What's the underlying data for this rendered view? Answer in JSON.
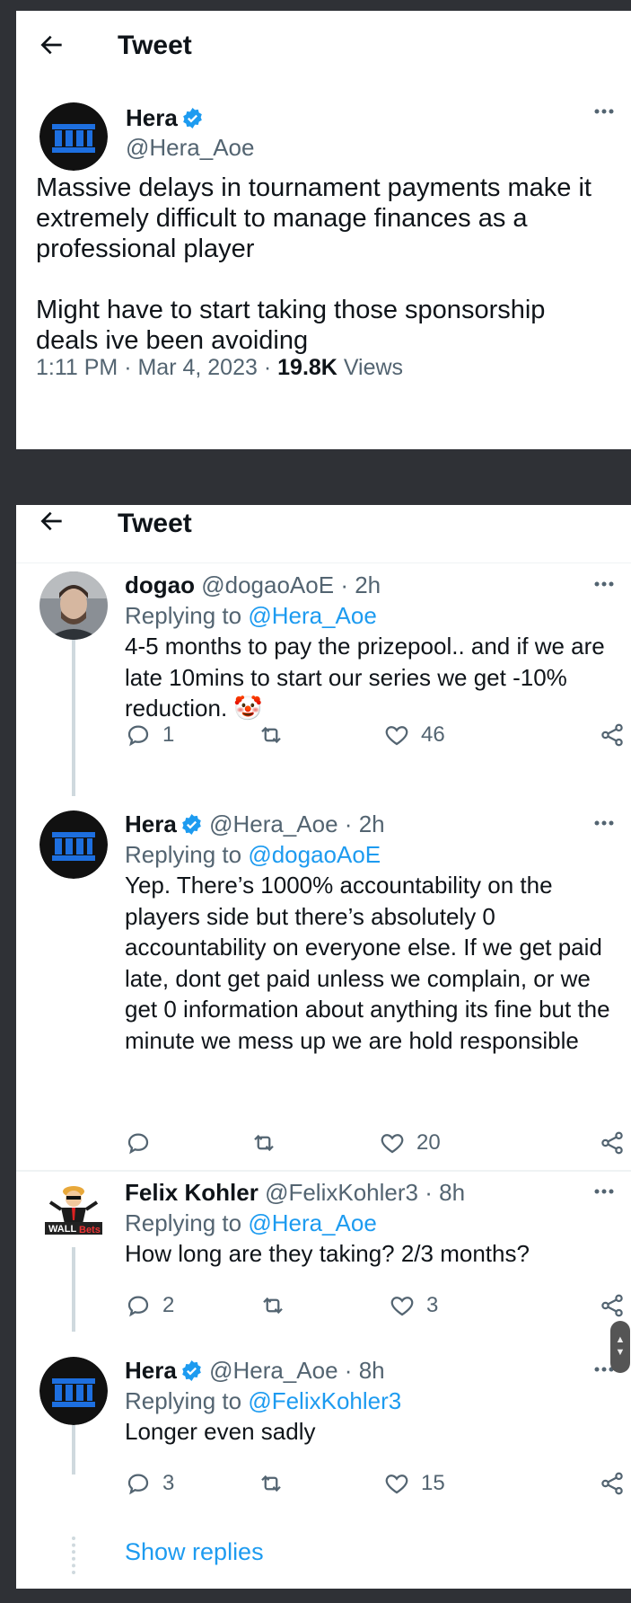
{
  "header": {
    "title": "Tweet"
  },
  "main_tweet": {
    "name": "Hera",
    "handle": "@Hera_Aoe",
    "text_p1": "Massive delays in tournament payments make it extremely difficult to manage finances as a professional player",
    "text_p2": "Might have to start taking those sponsorship deals ive been avoiding",
    "time": "1:11 PM",
    "date": "Mar 4, 2023",
    "views_count": "19.8K",
    "views_label": "Views"
  },
  "replies": [
    {
      "name": "dogao",
      "handle": "@dogaoAoE",
      "time": "2h",
      "replying_prefix": "Replying to",
      "replying_to": "@Hera_Aoe",
      "text": "4-5 months to pay the prizepool.. and if we are late 10mins to start our series we get -10% reduction. 🤡",
      "replies_count": "1",
      "retweets_count": "",
      "likes_count": "46"
    },
    {
      "name": "Hera",
      "handle": "@Hera_Aoe",
      "time": "2h",
      "replying_prefix": "Replying to",
      "replying_to": "@dogaoAoE",
      "text": "Yep. There’s 1000% accountability on the players side  but there’s absolutely 0 accountability on everyone else. If we get paid late, dont get paid unless we complain, or we get 0 information about anything its fine but the minute we mess up we are hold responsible",
      "replies_count": "",
      "retweets_count": "",
      "likes_count": "20"
    },
    {
      "name": "Felix Kohler",
      "handle": "@FelixKohler3",
      "time": "8h",
      "replying_prefix": "Replying to",
      "replying_to": "@Hera_Aoe",
      "text": "How long are they taking? 2/3 months?",
      "replies_count": "2",
      "retweets_count": "",
      "likes_count": "3"
    },
    {
      "name": "Hera",
      "handle": "@Hera_Aoe",
      "time": "8h",
      "replying_prefix": "Replying to",
      "replying_to": "@FelixKohler3",
      "text": "Longer even sadly",
      "replies_count": "3",
      "retweets_count": "",
      "likes_count": "15"
    }
  ],
  "show_replies": "Show replies",
  "separator": "·",
  "icons": {
    "back": "arrow-left-icon",
    "more": "more-dots-icon",
    "verified": "verified-badge-icon",
    "reply": "reply-bubble-icon",
    "retweet": "retweet-icon",
    "like": "heart-icon",
    "share": "share-icon"
  },
  "colors": {
    "accent": "#1d9bf0",
    "text": "#0f1419",
    "muted": "#536471",
    "background": "#2f3136"
  }
}
